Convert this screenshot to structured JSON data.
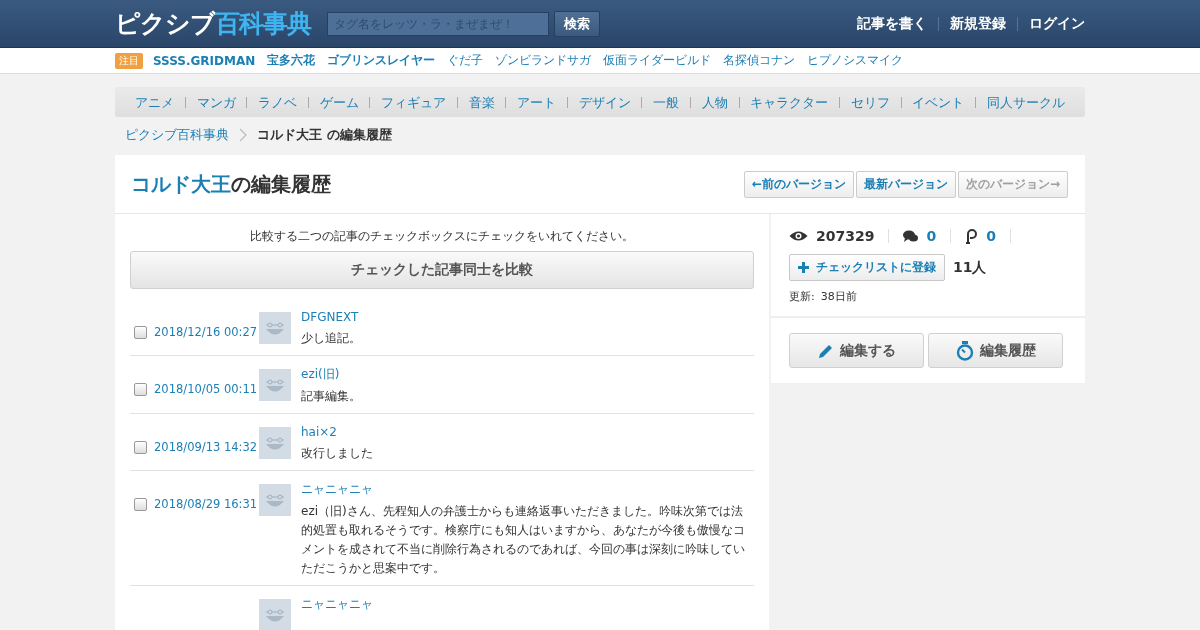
{
  "header": {
    "logo": {
      "main": "ピクシブ",
      "accent": "百科事典"
    },
    "search": {
      "placeholder": "タグ名をレッツ・ラ・まぜまぜ！",
      "button": "検索"
    },
    "links": [
      "記事を書く",
      "新規登録",
      "ログイン"
    ]
  },
  "trending": {
    "badge": "注目",
    "items": [
      {
        "label": "SSSS.GRIDMAN",
        "bold": true
      },
      {
        "label": "宝多六花",
        "bold": true
      },
      {
        "label": "ゴブリンスレイヤー",
        "bold": true
      },
      {
        "label": "ぐだ子",
        "bold": false
      },
      {
        "label": "ゾンビランドサガ",
        "bold": false
      },
      {
        "label": "仮面ライダービルド",
        "bold": false
      },
      {
        "label": "名探偵コナン",
        "bold": false
      },
      {
        "label": "ヒプノシスマイク",
        "bold": false
      }
    ]
  },
  "categories": [
    "アニメ",
    "マンガ",
    "ラノベ",
    "ゲーム",
    "フィギュア",
    "音楽",
    "アート",
    "デザイン",
    "一般",
    "人物",
    "キャラクター",
    "セリフ",
    "イベント",
    "同人サークル"
  ],
  "breadcrumb": [
    {
      "label": "ピクシブ百科事典",
      "current": false
    },
    {
      "label": "コルド大王 の編集履歴",
      "current": true
    }
  ],
  "title": {
    "article": "コルド大王",
    "suffix": "の編集履歴"
  },
  "version_buttons": [
    {
      "label": "←前のバージョン",
      "disabled": false
    },
    {
      "label": "最新バージョン",
      "disabled": false
    },
    {
      "label": "次のバージョン→",
      "disabled": true
    }
  ],
  "history": {
    "instruction": "比較する二つの記事のチェックボックスにチェックをいれてください。",
    "compare_button": "チェックした記事同士を比較",
    "entries": [
      {
        "checked": false,
        "date": "2018/12/16 00:27",
        "user": "DFGNEXT",
        "comment": "少し追記。"
      },
      {
        "checked": false,
        "date": "2018/10/05 00:11",
        "user": "ezi(旧)",
        "comment": "記事編集。"
      },
      {
        "checked": false,
        "date": "2018/09/13 14:32",
        "user": "hai×2",
        "comment": "改行しました"
      },
      {
        "checked": false,
        "date": "2018/08/29 16:31",
        "user": "ニャニャニャ",
        "comment": "ezi（旧)さん、先程知人の弁護士からも連絡返事いただきました。吟味次第では法的処置も取れるそうです。検察庁にも知人はいますから、あなたが今後も傲慢なコメントを成されて不当に削除行為されるのであれば、今回の事は深刻に吟味していただこうかと思案中です。"
      },
      {
        "user": "ニャニャニャ"
      }
    ]
  },
  "stats": {
    "views": "207329",
    "comments": "0",
    "pixiv": "0",
    "checklist_button": "チェックリストに登録",
    "checklist_count": "11人",
    "updated_label": "更新:",
    "updated": "38日前"
  },
  "actions": [
    {
      "kind": "edit",
      "label": "編集する"
    },
    {
      "kind": "history",
      "label": "編集履歴"
    }
  ]
}
